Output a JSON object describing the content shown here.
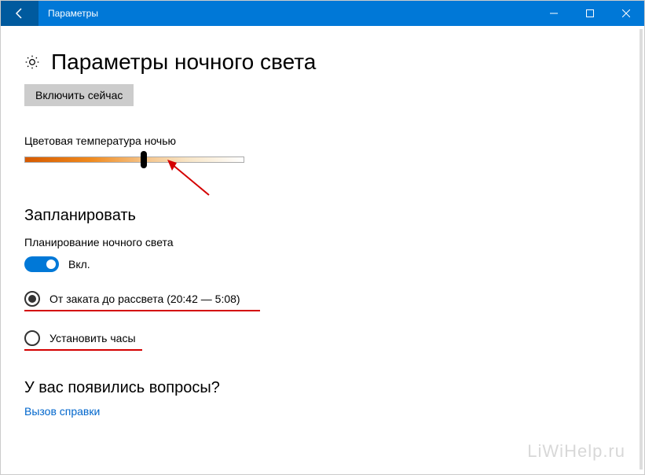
{
  "titlebar": {
    "title": "Параметры"
  },
  "page": {
    "title": "Параметры ночного света"
  },
  "turn_on": {
    "label": "Включить сейчас"
  },
  "color_temp": {
    "label": "Цветовая температура ночью"
  },
  "schedule": {
    "heading": "Запланировать",
    "planning_label": "Планирование ночного света",
    "toggle_text": "Вкл.",
    "option_sunset": "От заката до рассвета (20:42 — 5:08)",
    "option_hours": "Установить часы"
  },
  "questions": {
    "heading": "У вас появились вопросы?",
    "help_link": "Вызов справки"
  },
  "watermark": "LiWiHelp.ru"
}
